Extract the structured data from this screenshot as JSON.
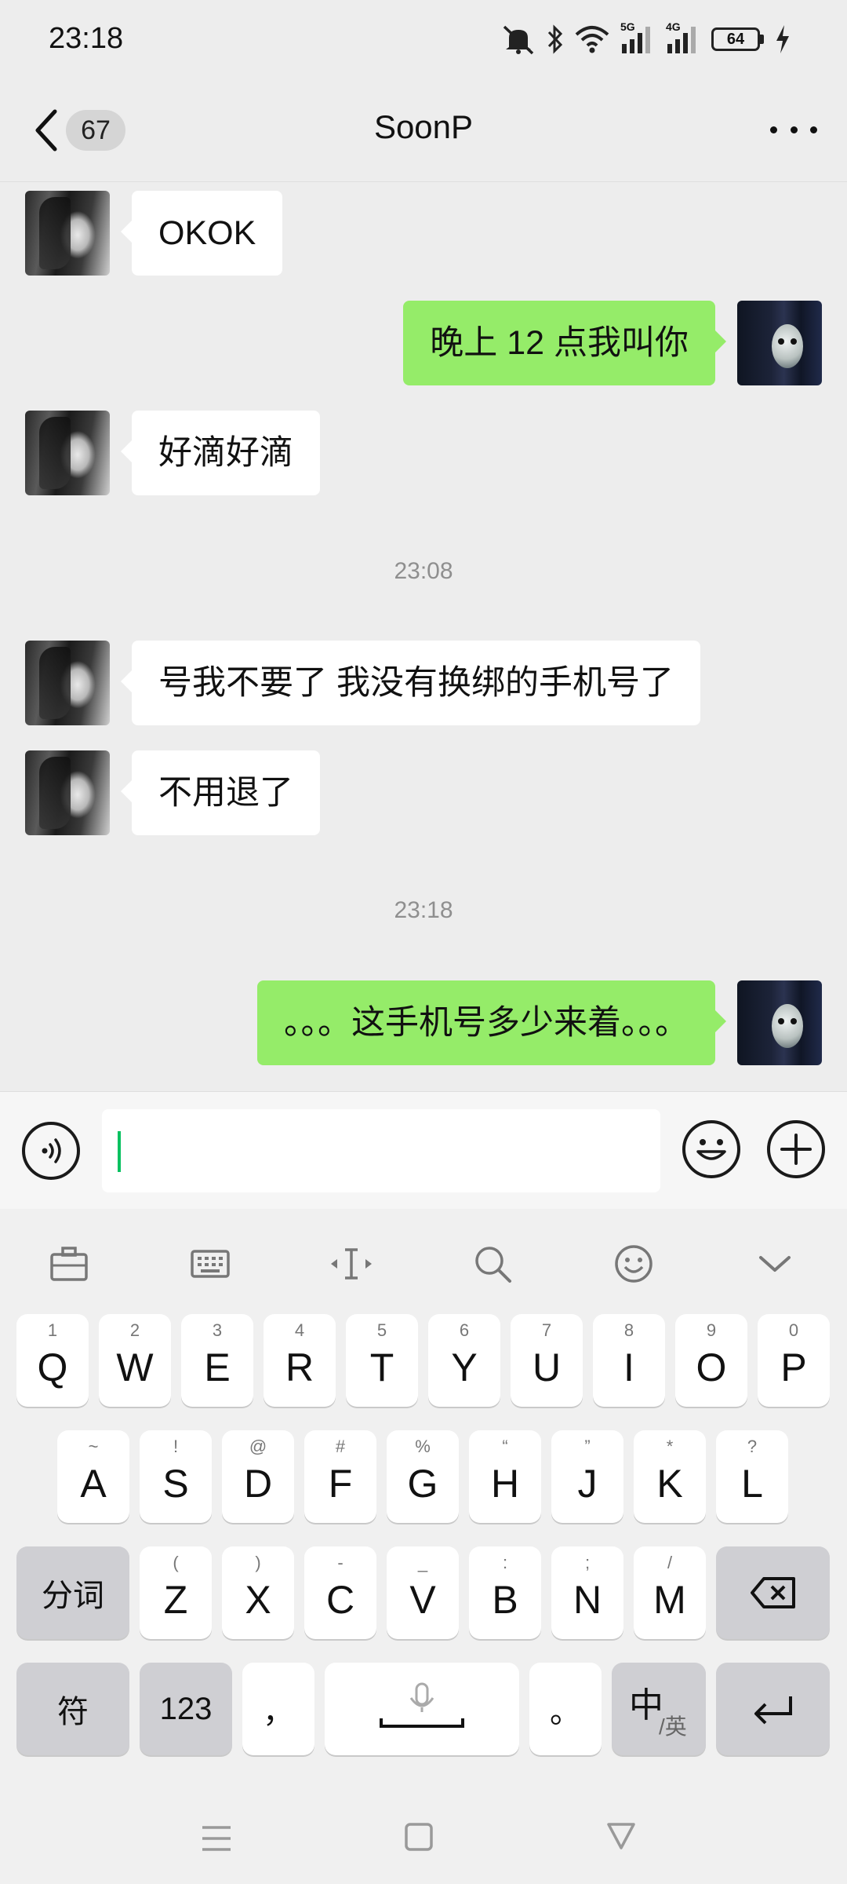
{
  "status_bar": {
    "time": "23:18",
    "network_5g": "5G",
    "network_4g": "4G",
    "battery": "64",
    "icons": [
      "mute-bell-icon",
      "bluetooth-icon",
      "wifi-icon",
      "signal-5g-icon",
      "signal-4g-icon",
      "battery-icon",
      "charging-icon"
    ]
  },
  "nav": {
    "unread_count": "67",
    "title": "SoonP"
  },
  "chat": {
    "messages": [
      {
        "side": "left",
        "text": "OKOK"
      },
      {
        "side": "right",
        "text": "晚上 12 点我叫你"
      },
      {
        "side": "left",
        "text": "好滴好滴"
      },
      {
        "side": "time",
        "text": "23:08"
      },
      {
        "side": "left",
        "text": "号我不要了 我没有换绑的手机号了"
      },
      {
        "side": "left",
        "text": "不用退了"
      },
      {
        "side": "time",
        "text": "23:18"
      },
      {
        "side": "right",
        "text": "。。。这手机号多少来着。。。"
      }
    ]
  },
  "input": {
    "value": ""
  },
  "keyboard": {
    "toolbar": [
      "clipboard-icon",
      "keyboard-icon",
      "cursor-move-icon",
      "search-icon",
      "emoji-icon",
      "collapse-icon"
    ],
    "row1": [
      {
        "hint": "1",
        "key": "Q"
      },
      {
        "hint": "2",
        "key": "W"
      },
      {
        "hint": "3",
        "key": "E"
      },
      {
        "hint": "4",
        "key": "R"
      },
      {
        "hint": "5",
        "key": "T"
      },
      {
        "hint": "6",
        "key": "Y"
      },
      {
        "hint": "7",
        "key": "U"
      },
      {
        "hint": "8",
        "key": "I"
      },
      {
        "hint": "9",
        "key": "O"
      },
      {
        "hint": "0",
        "key": "P"
      }
    ],
    "row2": [
      {
        "hint": "~",
        "key": "A"
      },
      {
        "hint": "!",
        "key": "S"
      },
      {
        "hint": "@",
        "key": "D"
      },
      {
        "hint": "#",
        "key": "F"
      },
      {
        "hint": "%",
        "key": "G"
      },
      {
        "hint": "“",
        "key": "H"
      },
      {
        "hint": "”",
        "key": "J"
      },
      {
        "hint": "*",
        "key": "K"
      },
      {
        "hint": "?",
        "key": "L"
      }
    ],
    "row3": [
      {
        "hint": "(",
        "key": "Z"
      },
      {
        "hint": ")",
        "key": "X"
      },
      {
        "hint": "-",
        "key": "C"
      },
      {
        "hint": "_",
        "key": "V"
      },
      {
        "hint": ":",
        "key": "B"
      },
      {
        "hint": ";",
        "key": "N"
      },
      {
        "hint": "/",
        "key": "M"
      }
    ],
    "segment_label": "分词",
    "symbols_label": "符",
    "numbers_label": "123",
    "comma_label": "，",
    "period_label": "。",
    "lang_main": "中",
    "lang_sub": "/英"
  }
}
